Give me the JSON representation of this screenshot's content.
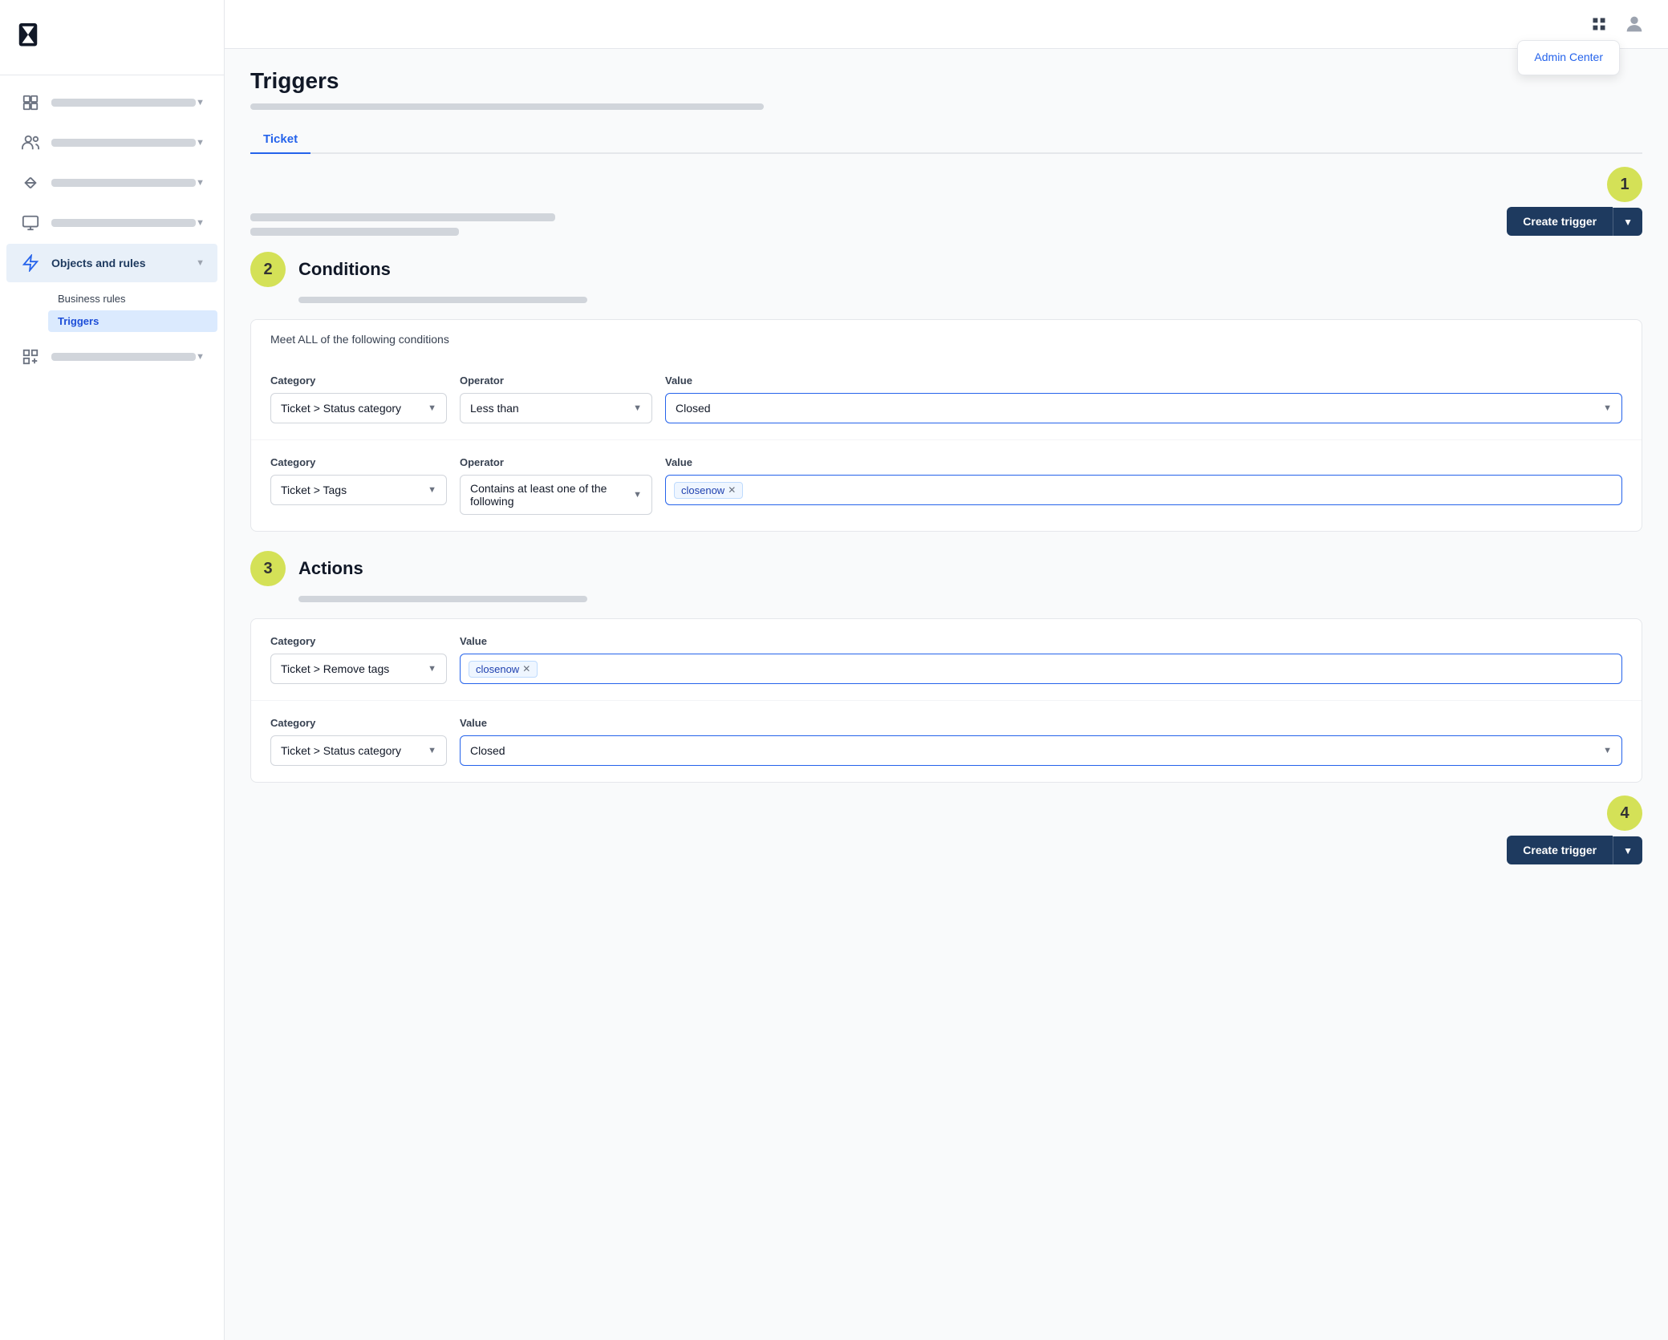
{
  "sidebar": {
    "logo_alt": "Zendesk",
    "nav_items": [
      {
        "id": "home",
        "icon": "🏢",
        "active": false
      },
      {
        "id": "people",
        "icon": "👥",
        "active": false
      },
      {
        "id": "routing",
        "icon": "⇄",
        "active": false
      },
      {
        "id": "screen",
        "icon": "🖥",
        "active": false
      },
      {
        "id": "objects",
        "icon": "⚡",
        "active": true,
        "label": "Objects and rules"
      },
      {
        "id": "grid-plus",
        "icon": "⊞",
        "active": false
      }
    ],
    "sub_items": [
      {
        "id": "business-rules",
        "label": "Business rules",
        "active": false
      },
      {
        "id": "triggers",
        "label": "Triggers",
        "active": true
      }
    ]
  },
  "header": {
    "admin_center_label": "Admin Center"
  },
  "page": {
    "title": "Triggers",
    "tab_label": "Ticket",
    "create_trigger_label": "Create trigger",
    "step1_badge": "1",
    "step2_badge": "2",
    "step3_badge": "3",
    "step4_badge": "4"
  },
  "conditions": {
    "section_title": "Conditions",
    "meet_all_label": "Meet ALL of the following conditions",
    "row1": {
      "category_label": "Category",
      "category_value": "Ticket > Status category",
      "operator_label": "Operator",
      "operator_value": "Less than",
      "value_label": "Value",
      "value_value": "Closed"
    },
    "row2": {
      "category_label": "Category",
      "category_value": "Ticket > Tags",
      "operator_label": "Operator",
      "operator_value": "Contains at least one of the following",
      "value_label": "Value",
      "tag_value": "closenow"
    }
  },
  "actions": {
    "section_title": "Actions",
    "row1": {
      "category_label": "Category",
      "category_value": "Ticket > Remove tags",
      "value_label": "Value",
      "tag_value": "closenow"
    },
    "row2": {
      "category_label": "Category",
      "category_value": "Ticket > Status category",
      "value_label": "Value",
      "value_value": "Closed"
    }
  }
}
